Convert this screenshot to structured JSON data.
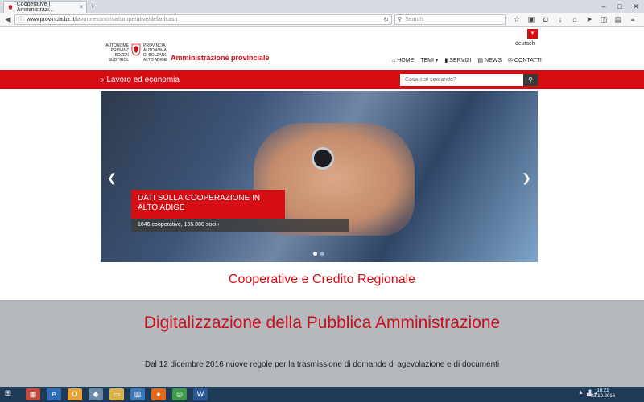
{
  "browser": {
    "tab_title": "Cooperative | Amministrazi...",
    "tab_close": "×",
    "new_tab": "+",
    "url_host": "www.provincia.bz.it",
    "url_path": "/lavoro-economia/cooperative/default.asp",
    "search_placeholder": "Search",
    "window_buttons": [
      "–",
      "□",
      "✕"
    ]
  },
  "site": {
    "language": "deutsch",
    "logo_left": [
      "AUTONOME",
      "PROVINZ",
      "BOZEN",
      "SÜDTIROL"
    ],
    "logo_right": [
      "PROVINCIA",
      "AUTONOMA",
      "DI BOLZANO",
      "ALTO ADIGE"
    ],
    "title": "Amministrazione provinciale",
    "menu": [
      {
        "icon": "⌂",
        "label": "HOME"
      },
      {
        "icon": "",
        "label": "TEMI ▾"
      },
      {
        "icon": "▮",
        "label": "SERVIZI"
      },
      {
        "icon": "▤",
        "label": "NEWS"
      },
      {
        "icon": "✉",
        "label": "CONTATTI"
      }
    ],
    "section_title": "» Lavoro ed economia",
    "search_placeholder": "Cosa stai cercando?"
  },
  "carousel": {
    "headline": "DATI SULLA COOPERAZIONE IN ALTO ADIGE",
    "subline": "1046 cooperative, 165.000 soci ›",
    "slide_count": 2,
    "active_slide": 0
  },
  "content": {
    "coop_title": "Cooperative e Credito Regionale",
    "dig_title": "Digitalizzazione della Pubblica Amministrazione",
    "dig_text": "Dal 12 dicembre 2016 nuove regole per la trasmissione di domande di agevolazione e di documenti"
  },
  "taskbar": {
    "time": "10:21",
    "date": "03.10.2016"
  },
  "colors": {
    "brand_red": "#d40e14",
    "taskbar": "#1d3b57"
  }
}
